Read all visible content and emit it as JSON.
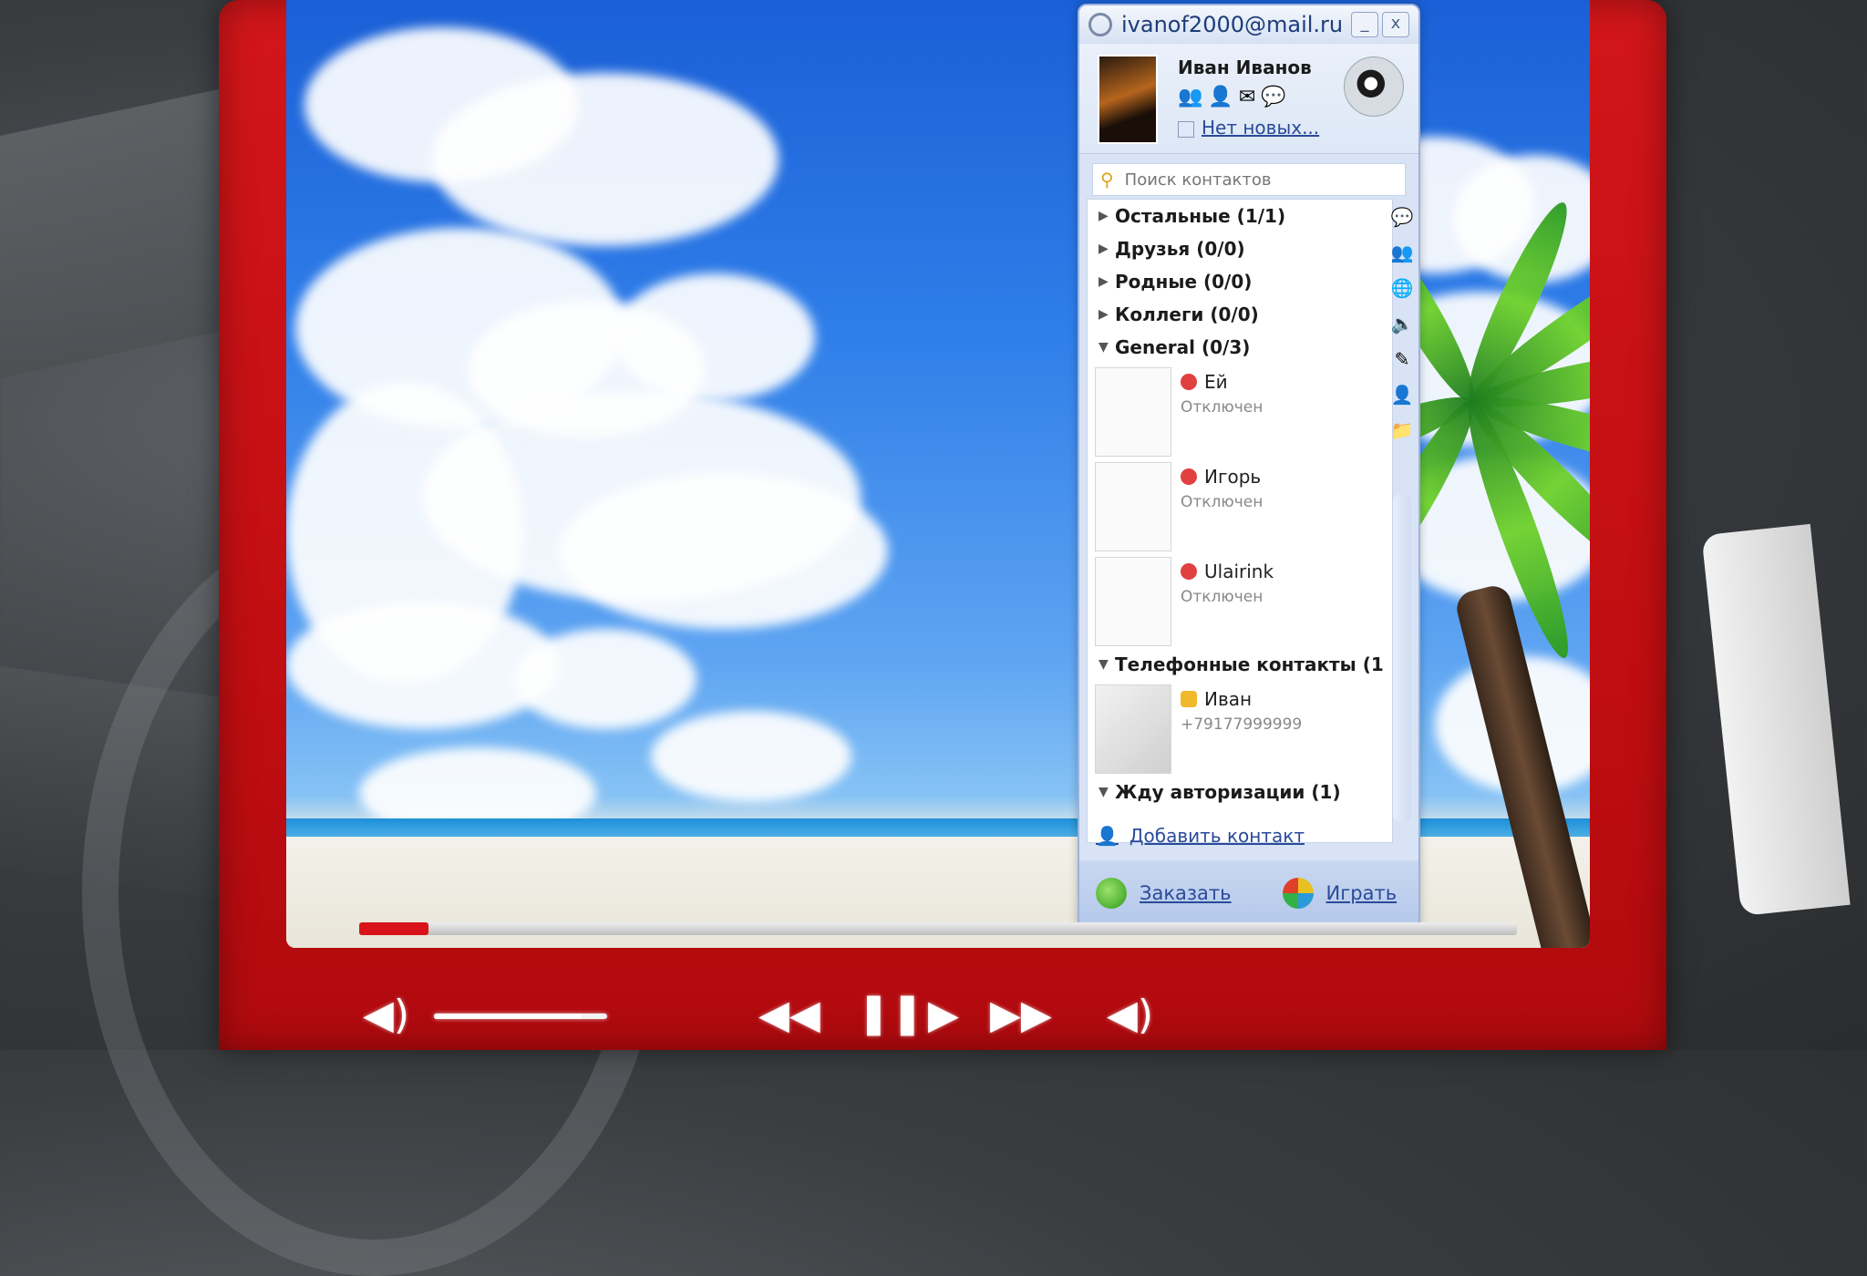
{
  "window": {
    "title": "ivanof2000@mail.ru",
    "minimize_icon": "minimize-icon",
    "close_label": "x"
  },
  "profile": {
    "name": "Иван Иванов",
    "status_link": "Нет новых..."
  },
  "search": {
    "placeholder": "Поиск контактов"
  },
  "groups": [
    {
      "label": "Остальные (1/1)"
    },
    {
      "label": "Друзья (0/0)"
    },
    {
      "label": "Родные (0/0)"
    },
    {
      "label": "Коллеги (0/0)"
    },
    {
      "label": "General (0/3)"
    }
  ],
  "contacts": [
    {
      "name": "Ей",
      "status": "Отключен"
    },
    {
      "name": "Игорь",
      "status": "Отключен"
    },
    {
      "name": "Ulairink",
      "status": "Отключен"
    }
  ],
  "phone_group": {
    "label": "Телефонные контакты (1"
  },
  "phone_contact": {
    "name": "Иван",
    "number": "+79177999999"
  },
  "auth_group": {
    "label": "Жду авторизации (1)"
  },
  "add_contact": "Добавить контакт",
  "bottom": {
    "status_label": "Заказать",
    "games_label": "Играть"
  },
  "player": {
    "progress": 0.06,
    "volume": 0.85,
    "accent_color": "#d2161a"
  }
}
